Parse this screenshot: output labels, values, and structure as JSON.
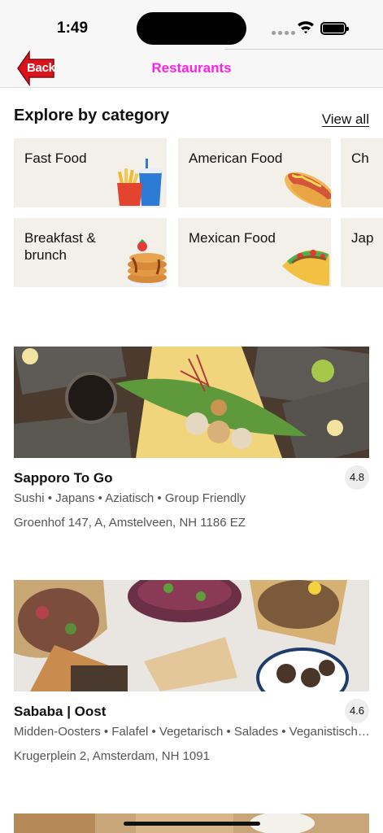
{
  "status_bar": {
    "time": "1:49"
  },
  "nav": {
    "back_label": "Back",
    "title": "Restaurants"
  },
  "explore": {
    "title": "Explore by category",
    "view_all": "View all",
    "categories": [
      {
        "label": "Fast Food",
        "icon": "fries-soda-icon"
      },
      {
        "label": "American Food",
        "icon": "hotdog-icon"
      },
      {
        "label": "Ch",
        "icon": ""
      },
      {
        "label": "Breakfast & brunch",
        "icon": "pancakes-icon"
      },
      {
        "label": "Mexican Food",
        "icon": "taco-icon"
      },
      {
        "label": "Jap",
        "icon": ""
      }
    ]
  },
  "restaurants": [
    {
      "name": "Sapporo To Go",
      "rating": "4.8",
      "tags": "Sushi • Japans • Aziatisch • Group Friendly",
      "address": "Groenhof 147, A, Amstelveen, NH 1186 EZ"
    },
    {
      "name": "Sababa | Oost",
      "rating": "4.6",
      "tags": "Midden-Oosters • Falafel • Vegetarisch • Salades • Veganistisch…",
      "address": "Krugerplein 2, Amsterdam, NH 1091"
    }
  ],
  "colors": {
    "nav_title": "#ff1fe9",
    "back_button": "#d9121b",
    "category_bg": "#f3efe9"
  }
}
